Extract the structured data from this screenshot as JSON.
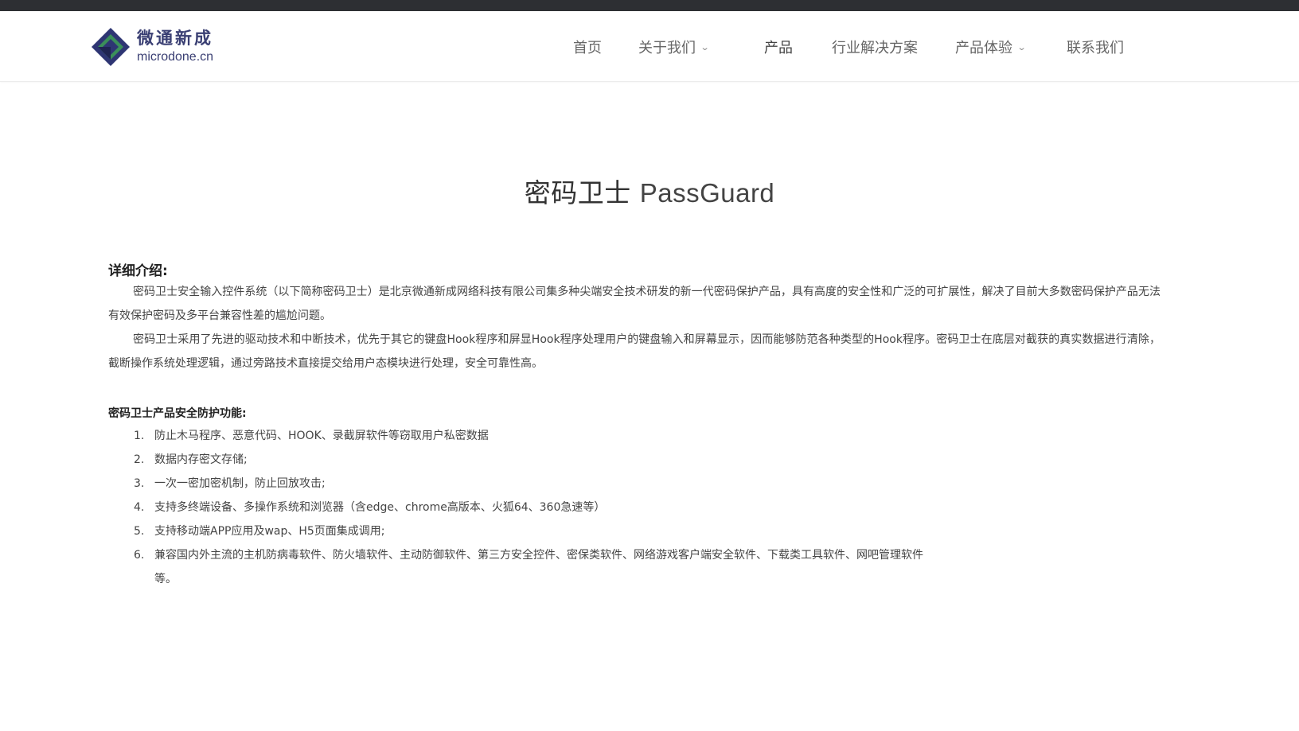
{
  "site": {
    "logo_cn": "微通新成",
    "logo_en": "microdone.cn"
  },
  "nav": {
    "items": [
      {
        "label": "首页"
      },
      {
        "label": "关于我们"
      },
      {
        "label": "产品"
      },
      {
        "label": "行业解决方案"
      },
      {
        "label": "产品体验"
      },
      {
        "label": "联系我们"
      }
    ]
  },
  "page": {
    "title_cn": "密码卫士",
    "title_en": "PassGuard"
  },
  "intro": {
    "heading": "详细介绍:",
    "paragraphs": [
      "密码卫士安全输入控件系统（以下简称密码卫士）是北京微通新成网络科技有限公司集多种尖端安全技术研发的新一代密码保护产品，具有高度的安全性和广泛的可扩展性，解决了目前大多数密码保护产品无法有效保护密码及多平台兼容性差的尴尬问题。",
      "密码卫士采用了先进的驱动技术和中断技术，优先于其它的键盘Hook程序和屏显Hook程序处理用户的键盘输入和屏幕显示，因而能够防范各种类型的Hook程序。密码卫士在底层对截获的真实数据进行清除，截断操作系统处理逻辑，通过旁路技术直接提交给用户态模块进行处理，安全可靠性高。"
    ]
  },
  "features": {
    "heading": "密码卫士产品安全防护功能:",
    "items": [
      {
        "num": "1.",
        "text": "防止木马程序、恶意代码、HOOK、录截屏软件等窃取用户私密数据"
      },
      {
        "num": "2.",
        "text": "数据内存密文存储;"
      },
      {
        "num": "3.",
        "text": "一次一密加密机制，防止回放攻击;"
      },
      {
        "num": "4.",
        "text": "支持多终端设备、多操作系统和浏览器（含edge、chrome高版本、火狐64、360急速等）"
      },
      {
        "num": "5.",
        "text": "支持移动端APP应用及wap、H5页面集成调用;"
      },
      {
        "num": "6.",
        "text": "兼容国内外主流的主机防病毒软件、防火墙软件、主动防御软件、第三方安全控件、密保类软件、网络游戏客户端安全软件、下载类工具软件、网吧管理软件等。"
      }
    ]
  }
}
